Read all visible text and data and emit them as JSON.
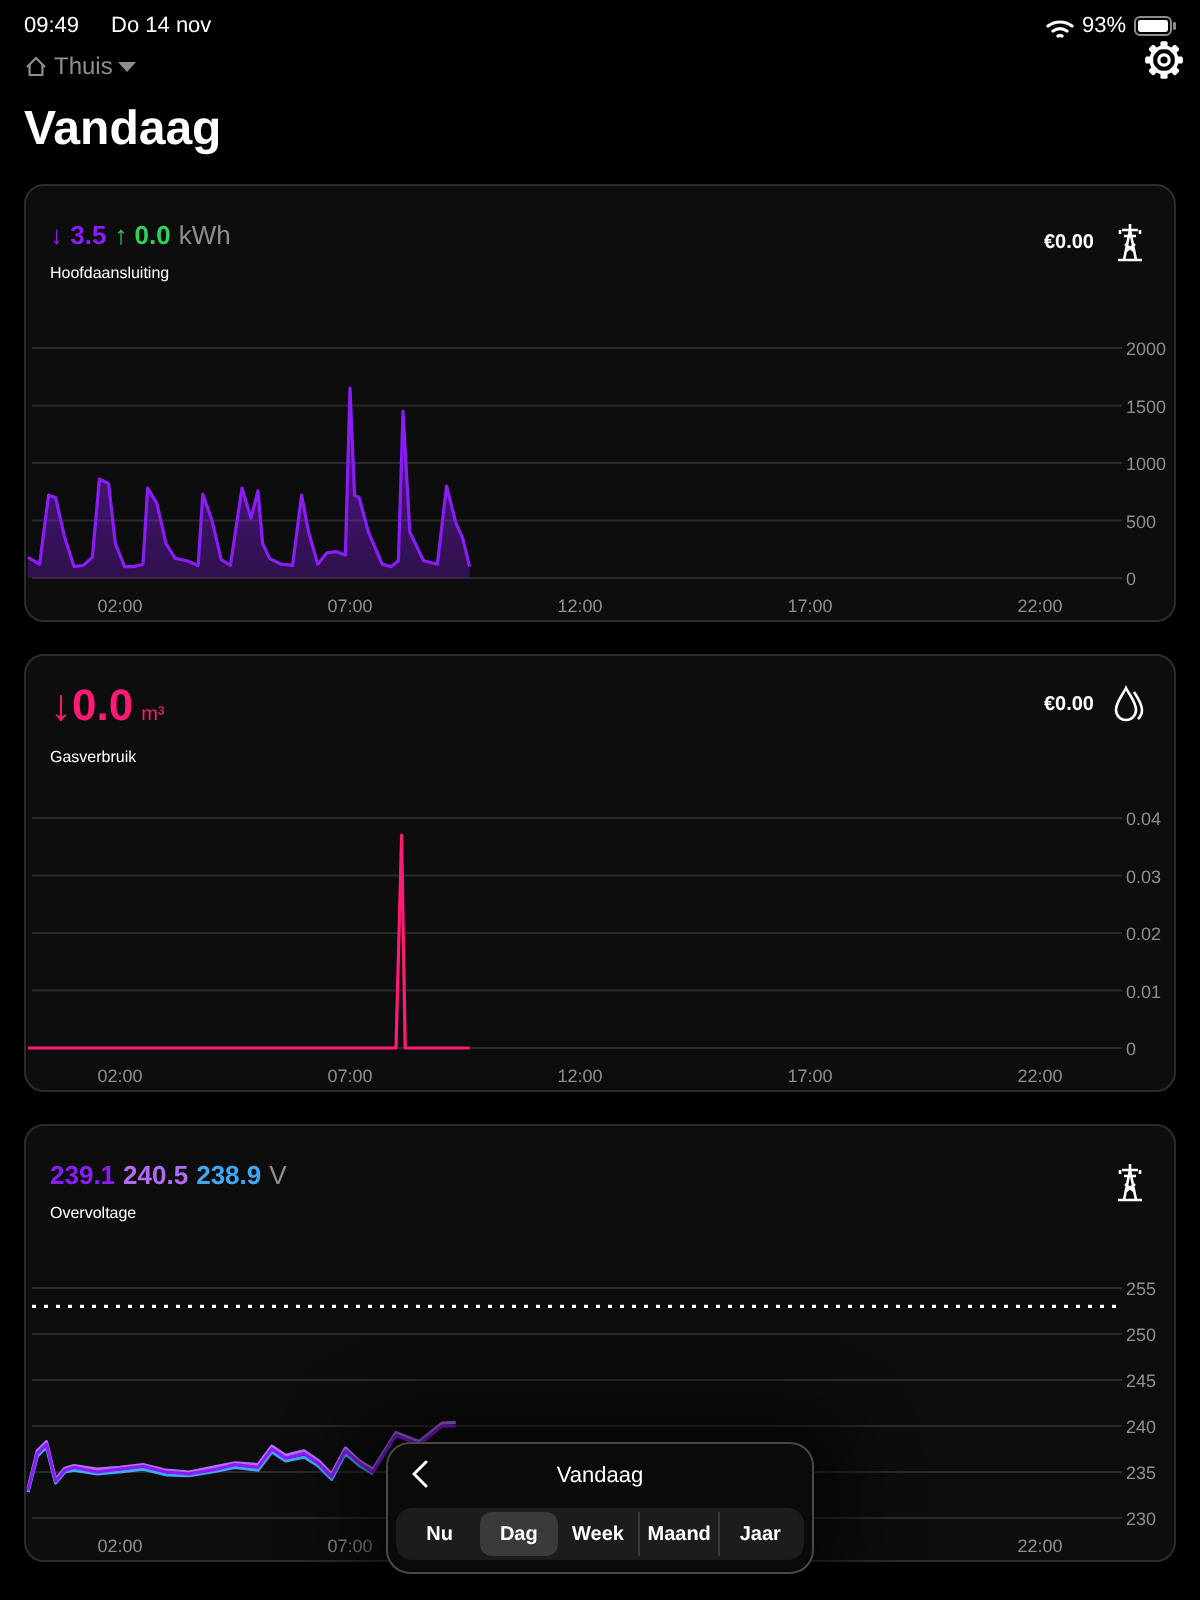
{
  "status_bar": {
    "time": "09:49",
    "date": "Do 14 nov",
    "battery": "93%"
  },
  "location": {
    "label": "Thuis"
  },
  "title": "Vandaag",
  "cards": [
    {
      "kind": "electricity",
      "readings": [
        {
          "arrow": "↓",
          "value": "3.5",
          "color": "#8a1cf5"
        },
        {
          "arrow": "↑",
          "value": "0.0",
          "color": "#2fd158"
        }
      ],
      "unit": "kWh",
      "label": "Hoofdaansluiting",
      "cost": "€0.00",
      "chart_data": {
        "type": "area",
        "x": [
          0,
          0.25,
          0.45,
          0.6,
          0.8,
          1.0,
          1.2,
          1.4,
          1.55,
          1.75,
          1.9,
          2.1,
          2.3,
          2.5,
          2.6,
          2.8,
          3.0,
          3.2,
          3.45,
          3.7,
          3.8,
          4.0,
          4.2,
          4.4,
          4.65,
          4.85,
          5.0,
          5.1,
          5.25,
          5.5,
          5.75,
          5.95,
          6.1,
          6.3,
          6.5,
          6.7,
          6.9,
          7.0,
          7.1,
          7.2,
          7.4,
          7.7,
          7.9,
          8.05,
          8.15,
          8.3,
          8.6,
          8.9,
          9.1,
          9.3,
          9.45,
          9.6
        ],
        "series": [
          {
            "color": "#8a1cf5",
            "values": [
              180,
              120,
              720,
              700,
              350,
              100,
              110,
              180,
              860,
              820,
              300,
              100,
              100,
              120,
              780,
              650,
              300,
              170,
              150,
              110,
              730,
              500,
              160,
              110,
              780,
              520,
              760,
              300,
              170,
              120,
              110,
              720,
              400,
              120,
              220,
              230,
              200,
              1650,
              720,
              700,
              400,
              120,
              100,
              150,
              1450,
              400,
              150,
              120,
              800,
              480,
              350,
              100
            ]
          }
        ],
        "xlim": [
          0,
          24
        ],
        "ylim": [
          0,
          2000
        ],
        "yticks": [
          0,
          500,
          1000,
          1500,
          2000
        ],
        "grid": true,
        "xticks": [
          {
            "value": 2,
            "label": "02:00"
          },
          {
            "value": 7,
            "label": "07:00"
          },
          {
            "value": 12,
            "label": "12:00"
          },
          {
            "value": 17,
            "label": "17:00"
          },
          {
            "value": 22,
            "label": "22:00"
          }
        ]
      }
    },
    {
      "kind": "gas",
      "readings": [
        {
          "arrow": "↓",
          "value": "0.0",
          "color": "#ff1a75"
        }
      ],
      "unit": "m³",
      "label": "Gasverbruik",
      "cost": "€0.00",
      "chart_data": {
        "type": "line",
        "x": [
          0,
          8.0,
          8.12,
          8.2,
          8.3,
          9.6
        ],
        "series": [
          {
            "color": "#ff1a75",
            "values": [
              0,
              0,
              0.037,
              0,
              0,
              0
            ]
          }
        ],
        "xlim": [
          0,
          24
        ],
        "ylim": [
          0,
          0.04
        ],
        "yticks": [
          0,
          0.01,
          0.02,
          0.03,
          0.04
        ],
        "grid": true,
        "xticks": [
          {
            "value": 2,
            "label": "02:00"
          },
          {
            "value": 7,
            "label": "07:00"
          },
          {
            "value": 12,
            "label": "12:00"
          },
          {
            "value": 17,
            "label": "17:00"
          },
          {
            "value": 22,
            "label": "22:00"
          }
        ]
      }
    },
    {
      "kind": "voltage",
      "readings": [
        {
          "value": "239.1",
          "color": "#8a1cf5"
        },
        {
          "value": "240.5",
          "color": "#b46cf7"
        },
        {
          "value": "238.9",
          "color": "#3fa9f5"
        }
      ],
      "unit": "V",
      "label": "Overvoltage",
      "chart_data": {
        "type": "line",
        "x": [
          0,
          0.2,
          0.4,
          0.6,
          0.8,
          1,
          1.5,
          2,
          2.5,
          3,
          3.5,
          4,
          4.5,
          5,
          5.3,
          5.6,
          6,
          6.3,
          6.6,
          6.9,
          7.2,
          7.5,
          8,
          8.5,
          9,
          9.3
        ],
        "series": [
          {
            "color": "#3fa9f5",
            "values": [
              232.8,
              236.7,
              237.7,
              233.8,
              235,
              235.2,
              234.8,
              235,
              235.3,
              234.7,
              234.6,
              235,
              235.5,
              235.2,
              237.2,
              236.2,
              236.6,
              235.7,
              234.2,
              237,
              235.7,
              234.8,
              null,
              null,
              null,
              null
            ]
          },
          {
            "color": "#b46cf7",
            "values": [
              233.2,
              237.3,
              238.3,
              234.2,
              235.4,
              235.7,
              235.3,
              235.5,
              235.8,
              235.2,
              235,
              235.5,
              236,
              235.8,
              237.8,
              236.8,
              237.3,
              236.3,
              234.8,
              237.6,
              236.2,
              235.3,
              239.3,
              238.3,
              240.3,
              240.4
            ]
          },
          {
            "color": "#8a1cf5",
            "values": [
              233,
              237,
              238,
              234,
              235.2,
              235.5,
              235,
              235.3,
              235.6,
              235,
              234.8,
              235.2,
              235.8,
              235.5,
              237.5,
              236.5,
              237,
              236,
              234.5,
              237.3,
              236,
              235,
              239,
              238,
              240,
              240
            ]
          }
        ],
        "xlim": [
          0,
          24
        ],
        "ylim": [
          230,
          255
        ],
        "yticks": [
          230,
          235,
          240,
          245,
          250,
          255
        ],
        "ref_lines": [
          {
            "axis": "y",
            "value": 253
          }
        ],
        "grid": true,
        "xticks": [
          {
            "value": 2,
            "label": "02:00"
          },
          {
            "value": 7,
            "label": "07:00"
          },
          {
            "value": 22,
            "label": "22:00"
          }
        ]
      },
      "period_picker": {
        "title": "Vandaag",
        "options": [
          {
            "label": "Nu",
            "selected": false
          },
          {
            "label": "Dag",
            "selected": true
          },
          {
            "label": "Week",
            "selected": false
          },
          {
            "label": "Maand",
            "selected": false
          },
          {
            "label": "Jaar",
            "selected": false
          }
        ]
      }
    }
  ]
}
